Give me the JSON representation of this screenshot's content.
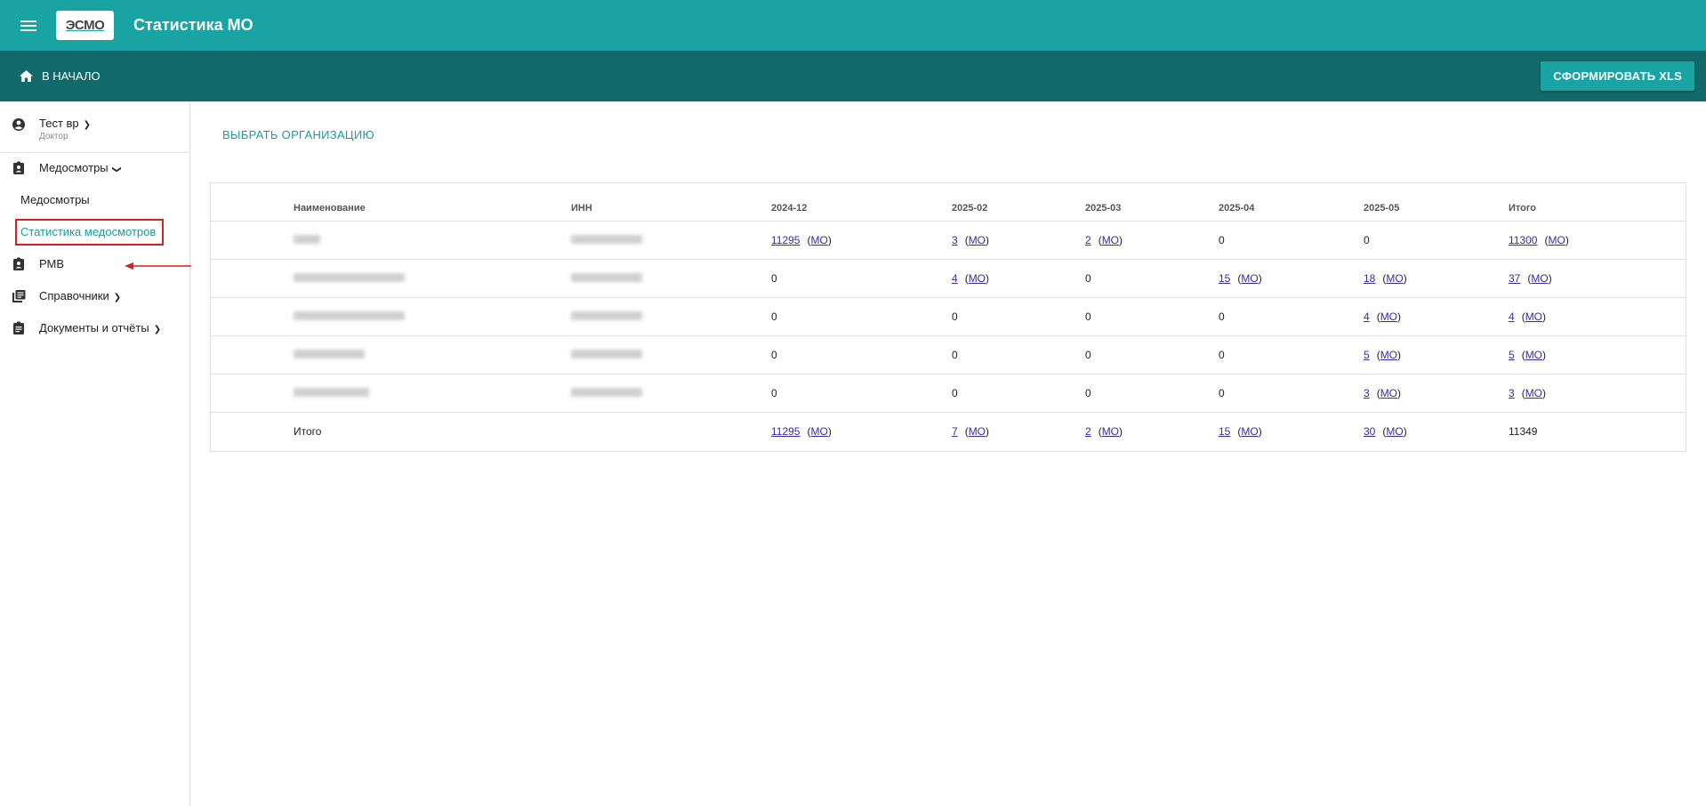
{
  "header": {
    "logo_text": "ЭСМО",
    "title": "Статистика МО"
  },
  "subbar": {
    "home_label": "В НАЧАЛО",
    "xls_button": "СФОРМИРОВАТЬ XLS"
  },
  "sidebar": {
    "user_name": "Тест вр",
    "user_role": "Доктор",
    "items": [
      {
        "label": "Медосмотры"
      },
      {
        "label": "РМВ"
      },
      {
        "label": "Справочники"
      },
      {
        "label": "Документы и отчёты"
      }
    ],
    "sub_items": [
      {
        "label": "Медосмотры"
      },
      {
        "label": "Статистика медосмотров"
      }
    ]
  },
  "main": {
    "select_org_label": "ВЫБРАТЬ ОРГАНИЗАЦИЮ"
  },
  "table": {
    "headers": [
      "Наименование",
      "ИНН",
      "2024-12",
      "2025-02",
      "2025-03",
      "2025-04",
      "2025-05",
      "Итого"
    ],
    "rows": [
      [
        "",
        "",
        "11295",
        "3",
        "2",
        "0",
        "0",
        "11300"
      ],
      [
        "",
        "",
        "0",
        "4",
        "0",
        "15",
        "18",
        "37"
      ],
      [
        "",
        "",
        "0",
        "0",
        "0",
        "0",
        "4",
        "4"
      ],
      [
        "",
        "",
        "0",
        "0",
        "0",
        "0",
        "5",
        "5"
      ],
      [
        "",
        "",
        "0",
        "0",
        "0",
        "0",
        "3",
        "3"
      ],
      [
        "Итого",
        "",
        "11295",
        "7",
        "2",
        "15",
        "30",
        "11349"
      ]
    ],
    "mo_label": "(МО)"
  }
}
